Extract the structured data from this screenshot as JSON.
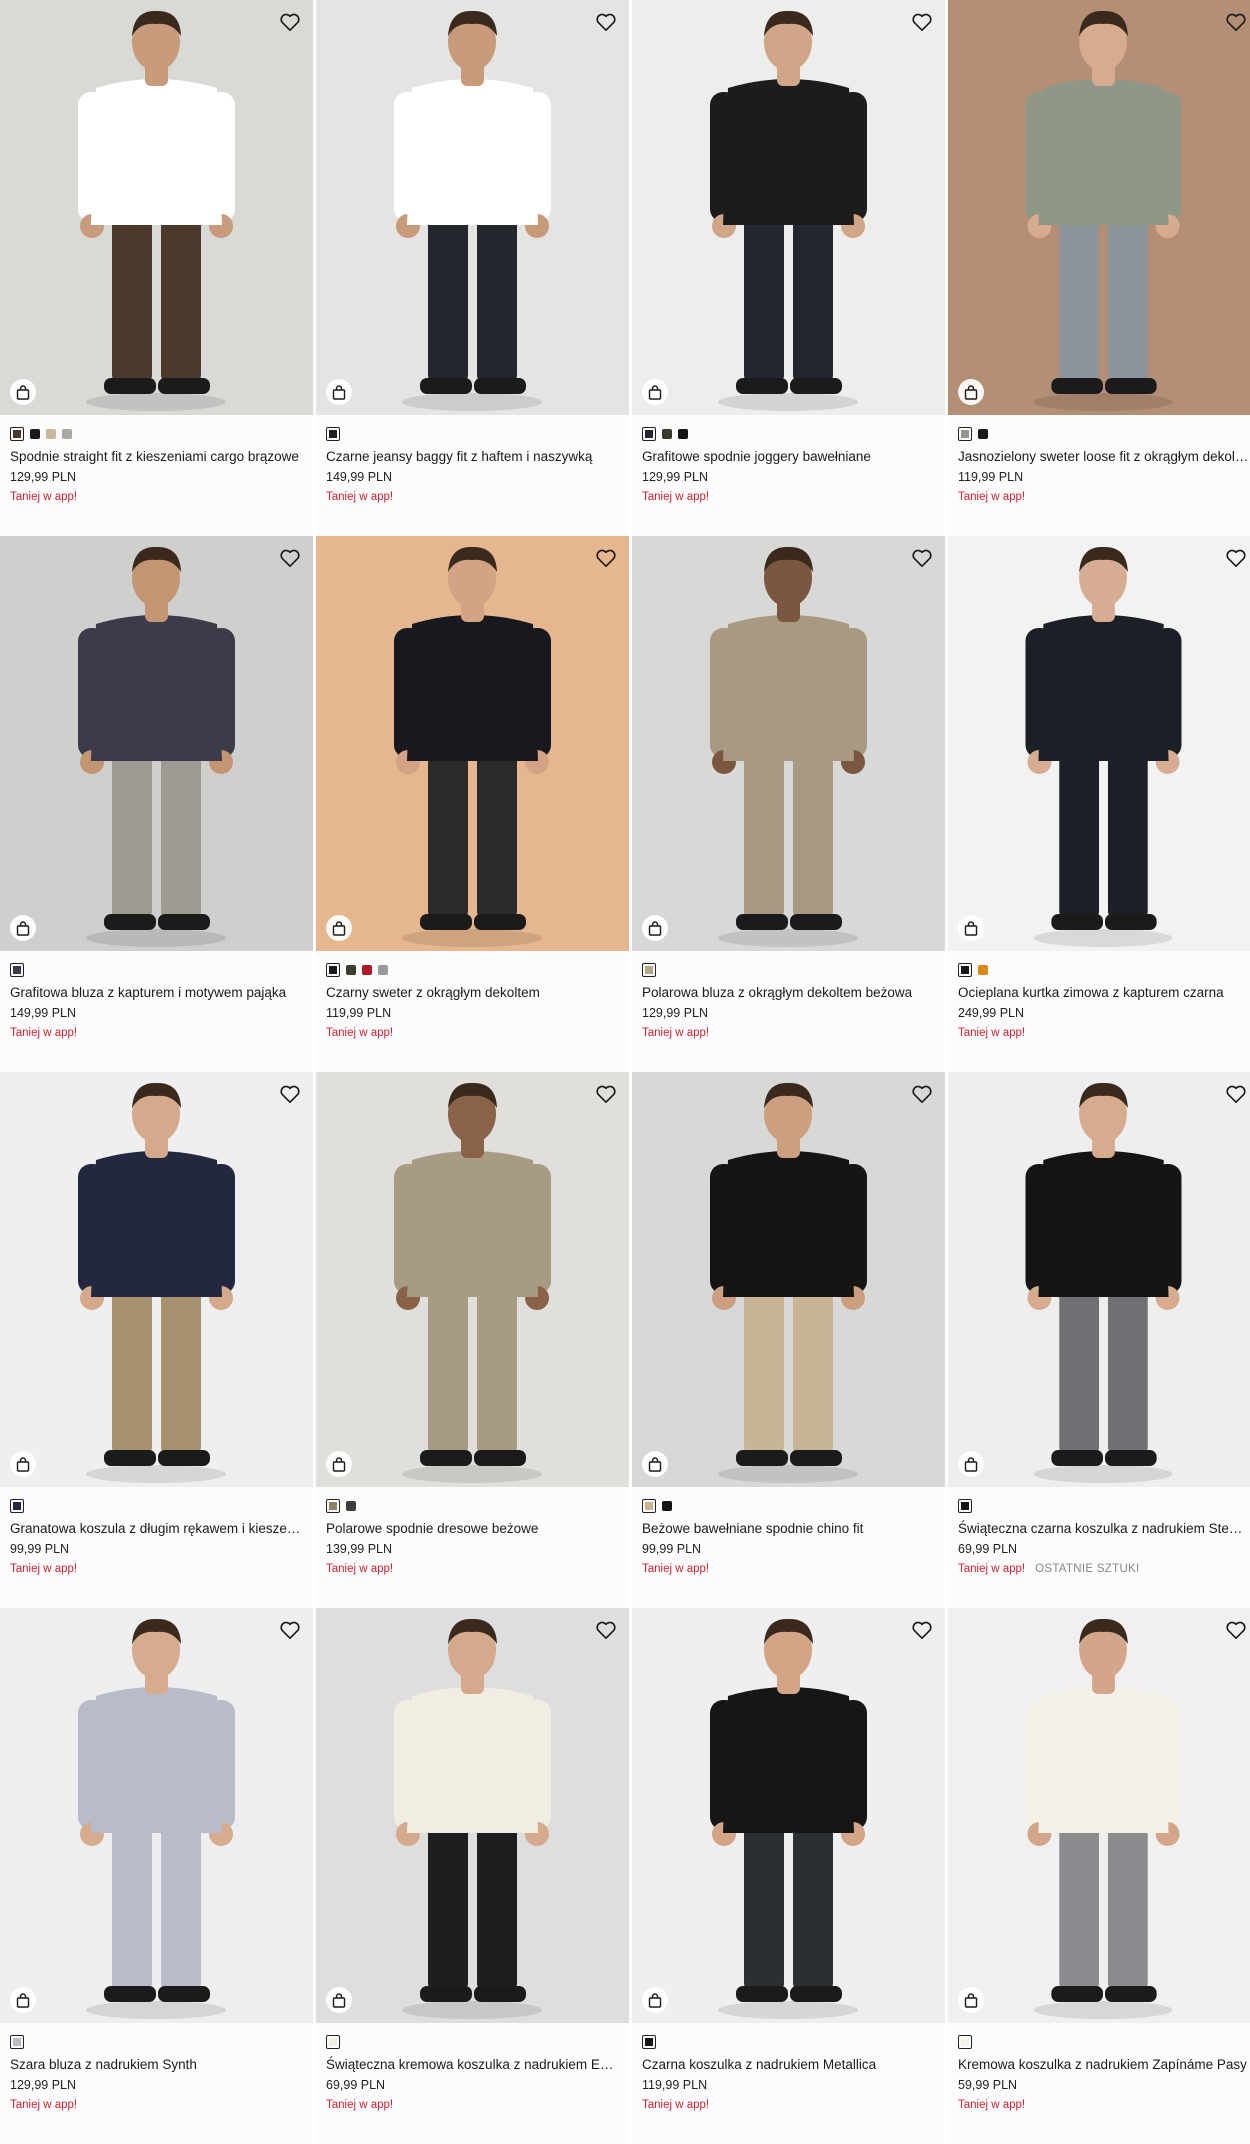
{
  "products": [
    {
      "title": "Spodnie straight fit z kieszeniami cargo brązowe",
      "price": "129,99 PLN",
      "promo": "Taniej w app!",
      "badge": "",
      "bg": "#d9d9d6",
      "top": "#ffffff",
      "bottom": "#4b3a2b",
      "skin": "#c89b7c",
      "swatches": [
        "#4b3a2b",
        "#1a1a1a",
        "#c8b99a",
        "#a8aaa2"
      ]
    },
    {
      "title": "Czarne jeansy baggy fit z haftem i naszywką",
      "price": "149,99 PLN",
      "promo": "Taniej w app!",
      "badge": "",
      "bg": "#e4e4e2",
      "top": "#ffffff",
      "bottom": "#23262c",
      "skin": "#c79a7a",
      "swatches": [
        "#1d1f24"
      ]
    },
    {
      "title": "Grafitowe spodnie joggery bawełniane",
      "price": "129,99 PLN",
      "promo": "Taniej w app!",
      "badge": "",
      "bg": "#ededec",
      "top": "#1c1c1d",
      "bottom": "#222730",
      "skin": "#d0a588",
      "swatches": [
        "#222730",
        "#3a3a2c",
        "#141414"
      ]
    },
    {
      "title": "Jasnozielony sweter loose fit z okrągłym dekoltem",
      "price": "119,99 PLN",
      "promo": "Taniej w app!",
      "badge": "",
      "bg": "#b48f76",
      "top": "#8f9886",
      "bottom": "#8e949b",
      "skin": "#d6ab8f",
      "swatches": [
        "#8f9886",
        "#1a1a1a"
      ]
    },
    {
      "title": "Grafitowa bluza z kapturem i motywem pająka",
      "price": "149,99 PLN",
      "promo": "Taniej w app!",
      "badge": "",
      "bg": "#cfcfcd",
      "top": "#3b3b4a",
      "bottom": "#9e9a92",
      "skin": "#c49573",
      "swatches": [
        "#3b3b4a"
      ]
    },
    {
      "title": "Czarny sweter z okrągłym dekoltem",
      "price": "119,99 PLN",
      "promo": "Taniej w app!",
      "badge": "",
      "bg": "#e6b78f",
      "top": "#17191e",
      "bottom": "#2a2a2a",
      "skin": "#d4a284",
      "swatches": [
        "#17191e",
        "#3d3a2e",
        "#b0182a",
        "#9a9a9a"
      ]
    },
    {
      "title": "Polarowa bluza z okrągłym dekoltem beżowa",
      "price": "129,99 PLN",
      "promo": "Taniej w app!",
      "badge": "",
      "bg": "#d8d8d6",
      "top": "#a89a82",
      "bottom": "#a89a82",
      "skin": "#7b5741",
      "swatches": [
        "#b5a58c"
      ]
    },
    {
      "title": "Ocieplana kurtka zimowa z kapturem czarna",
      "price": "249,99 PLN",
      "promo": "Taniej w app!",
      "badge": "",
      "bg": "#f2f2f2",
      "top": "#1c2026",
      "bottom": "#1c2026",
      "skin": "#d6ad92",
      "swatches": [
        "#15171a",
        "#d98a14"
      ]
    },
    {
      "title": "Granatowa koszula z długim rękawem i kieszenią",
      "price": "99,99 PLN",
      "promo": "Taniej w app!",
      "badge": "",
      "bg": "#efefef",
      "top": "#232840",
      "bottom": "#a8916e",
      "skin": "#d4a98c",
      "swatches": [
        "#232840"
      ]
    },
    {
      "title": "Polarowe spodnie dresowe beżowe",
      "price": "139,99 PLN",
      "promo": "Taniej w app!",
      "badge": "",
      "bg": "#e0dfdb",
      "top": "#a79b83",
      "bottom": "#a79b83",
      "skin": "#8a6248",
      "swatches": [
        "#8f806a",
        "#3d3d3d"
      ]
    },
    {
      "title": "Beżowe bawełniane spodnie chino fit",
      "price": "99,99 PLN",
      "promo": "Taniej w app!",
      "badge": "",
      "bg": "#d8d8d6",
      "top": "#151515",
      "bottom": "#c9b594",
      "skin": "#cc9f80",
      "swatches": [
        "#c9b594",
        "#141414"
      ]
    },
    {
      "title": "Świąteczna czarna koszulka z nadrukiem Steve Moore",
      "price": "69,99 PLN",
      "promo": "Taniej w app!",
      "badge": "OSTATNIE SZTUKI",
      "bg": "#eeeeee",
      "top": "#151515",
      "bottom": "#6f7074",
      "skin": "#d6ab8e",
      "swatches": [
        "#151515"
      ]
    },
    {
      "title": "Szara bluza z nadrukiem Synth",
      "price": "129,99 PLN",
      "promo": "Taniej w app!",
      "badge": "",
      "bg": "#eeeeee",
      "top": "#b7bcc8",
      "bottom": "#b7bcc8",
      "skin": "#d6ab8e",
      "swatches": [
        "#b9bcc4"
      ]
    },
    {
      "title": "Świąteczna kremowa koszulka z nadrukiem Extra Naughty",
      "price": "69,99 PLN",
      "promo": "Taniej w app!",
      "badge": "",
      "bg": "#dedede",
      "top": "#f1ede3",
      "bottom": "#1e1e1e",
      "skin": "#d4a98c",
      "swatches": [
        "#f1ede3"
      ]
    },
    {
      "title": "Czarna koszulka z nadrukiem Metallica",
      "price": "119,99 PLN",
      "promo": "Taniej w app!",
      "badge": "",
      "bg": "#efefef",
      "top": "#161616",
      "bottom": "#2b2e33",
      "skin": "#d3a486",
      "swatches": [
        "#161616"
      ]
    },
    {
      "title": "Kremowa koszulka z nadrukiem Zapínáme Pasy",
      "price": "59,99 PLN",
      "promo": "Taniej w app!",
      "badge": "",
      "bg": "#f0f0f0",
      "top": "#f3f0e8",
      "bottom": "#8a8c90",
      "skin": "#d3a68a",
      "swatches": [
        "#f3f0e8"
      ]
    }
  ]
}
